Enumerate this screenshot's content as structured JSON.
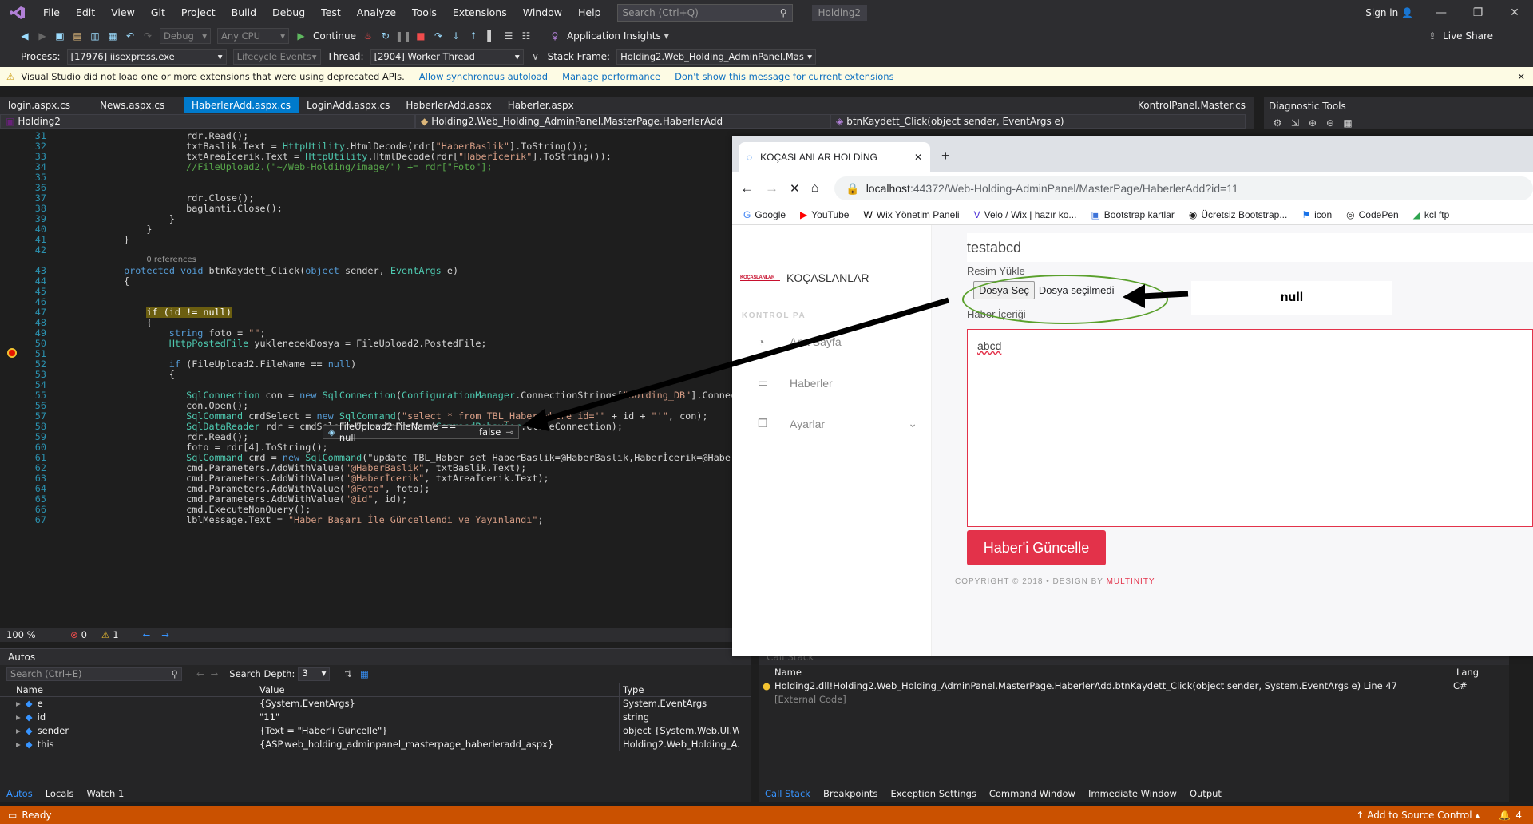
{
  "titlebar": {
    "menus": [
      "File",
      "Edit",
      "View",
      "Git",
      "Project",
      "Build",
      "Debug",
      "Test",
      "Analyze",
      "Tools",
      "Extensions",
      "Window",
      "Help"
    ],
    "search_placeholder": "Search (Ctrl+Q)",
    "solution": "Holding2",
    "signin": "Sign in"
  },
  "toolbar1": {
    "config": "Debug",
    "platform": "Any CPU",
    "continue": "Continue",
    "app_insights": "Application Insights",
    "live_share": "Live Share"
  },
  "toolbar2": {
    "process_label": "Process:",
    "process_value": "[17976] iisexpress.exe",
    "lifecycle": "Lifecycle Events",
    "thread_label": "Thread:",
    "thread_value": "[2904] Worker Thread",
    "stack_label": "Stack Frame:",
    "stack_value": "Holding2.Web_Holding_AdminPanel.Mas"
  },
  "infobar": {
    "message": "Visual Studio did not load one or more extensions that were using deprecated APIs.",
    "link1": "Allow synchronous autoload",
    "link2": "Manage performance",
    "link3": "Don't show this message for current extensions"
  },
  "tabs": [
    "login.aspx.cs",
    "News.aspx.cs",
    "HaberlerAdd.aspx.cs",
    "LoginAdd.aspx.cs",
    "HaberlerAdd.aspx",
    "Haberler.aspx",
    "KontrolPanel.Master.cs"
  ],
  "diagnostic_tools": "Diagnostic Tools",
  "navbar": {
    "project": "Holding2",
    "class": "Holding2.Web_Holding_AdminPanel.MasterPage.HaberlerAdd",
    "method": "btnKaydett_Click(object sender, EventArgs e)"
  },
  "code": [
    {
      "n": "31",
      "t": "rdr.Read();",
      "ind": 11
    },
    {
      "n": "32",
      "t": "txtBaslik.Text = HttpUtility.HtmlDecode(rdr[\"HaberBaslik\"].ToString());",
      "ind": 11
    },
    {
      "n": "33",
      "t": "txtAreaİcerik.Text = HttpUtility.HtmlDecode(rdr[\"Haberİcerik\"].ToString());",
      "ind": 11
    },
    {
      "n": "34",
      "t": "//FileUpload2.(\"~/Web-Holding/image/\") += rdr[\"Foto\"];",
      "ind": 11,
      "cm": true
    },
    {
      "n": "35",
      "t": "",
      "ind": 0
    },
    {
      "n": "36",
      "t": "",
      "ind": 0
    },
    {
      "n": "37",
      "t": "rdr.Close();",
      "ind": 11
    },
    {
      "n": "38",
      "t": "baglanti.Close();",
      "ind": 11
    },
    {
      "n": "39",
      "t": "}",
      "ind": 8
    },
    {
      "n": "40",
      "t": "}",
      "ind": 4
    },
    {
      "n": "41",
      "t": "}",
      "ind": 0
    },
    {
      "n": "42",
      "t": "",
      "ind": 0
    },
    {
      "n": "43",
      "t": "protected void btnKaydett_Click(object sender, EventArgs e)",
      "ind": 0
    },
    {
      "n": "44",
      "t": "{",
      "ind": 0
    },
    {
      "n": "45",
      "t": "",
      "ind": 0
    },
    {
      "n": "46",
      "t": "",
      "ind": 0
    },
    {
      "n": "47",
      "t": "if (id != null)",
      "ind": 4,
      "hl": true
    },
    {
      "n": "48",
      "t": "{",
      "ind": 4
    },
    {
      "n": "49",
      "t": "string foto = \"\";",
      "ind": 8
    },
    {
      "n": "50",
      "t": "HttpPostedFile yuklenecekDosya = FileUpload2.PostedFile;",
      "ind": 8
    },
    {
      "n": "51",
      "t": "",
      "ind": 0
    },
    {
      "n": "52",
      "t": "if (FileUpload2.FileName == null)",
      "ind": 8
    },
    {
      "n": "53",
      "t": "{",
      "ind": 8
    },
    {
      "n": "54",
      "t": "",
      "ind": 0
    },
    {
      "n": "55",
      "t": "SqlConnection con = new SqlConnection(ConfigurationManager.ConnectionStrings[\"Holding_DB\"].Connec",
      "ind": 11
    },
    {
      "n": "56",
      "t": "con.Open();",
      "ind": 11
    },
    {
      "n": "57",
      "t": "SqlCommand cmdSelect = new SqlCommand(\"select * from TBL_Haber where id='\" + id + \"'\", con);",
      "ind": 11
    },
    {
      "n": "58",
      "t": "SqlDataReader rdr = cmdSelect.ExecuteReader(CommandBehavior.CloseConnection);",
      "ind": 11
    },
    {
      "n": "59",
      "t": "rdr.Read();",
      "ind": 11
    },
    {
      "n": "60",
      "t": "foto = rdr[4].ToString();",
      "ind": 11
    },
    {
      "n": "61",
      "t": "SqlCommand cmd = new SqlCommand(\"update TBL_Haber set HaberBaslik=@HaberBaslik,Haberİcerik=@Haber",
      "ind": 11
    },
    {
      "n": "62",
      "t": "cmd.Parameters.AddWithValue(\"@HaberBaslik\", txtBaslik.Text);",
      "ind": 11
    },
    {
      "n": "63",
      "t": "cmd.Parameters.AddWithValue(\"@Haberİcerik\", txtAreaİcerik.Text);",
      "ind": 11
    },
    {
      "n": "64",
      "t": "cmd.Parameters.AddWithValue(\"@Foto\", foto);",
      "ind": 11
    },
    {
      "n": "65",
      "t": "cmd.Parameters.AddWithValue(\"@id\", id);",
      "ind": 11
    },
    {
      "n": "66",
      "t": "cmd.ExecuteNonQuery();",
      "ind": 11
    },
    {
      "n": "67",
      "t": "lblMessage.Text = \"Haber Başarı İle Güncellendi ve Yayınlandı\";",
      "ind": 11
    }
  ],
  "refs": "0 references",
  "datatip": {
    "expr": "FileUpload2.FileName == null",
    "value": "false"
  },
  "editor_status": {
    "zoom": "100 %",
    "errors": "0",
    "warnings": "1"
  },
  "autos": {
    "title": "Autos",
    "search": "Search (Ctrl+E)",
    "depth_label": "Search Depth:",
    "depth": "3",
    "headers": [
      "Name",
      "Value",
      "Type"
    ],
    "rows": [
      {
        "name": "e",
        "value": "{System.EventArgs}",
        "type": "System.EventArgs"
      },
      {
        "name": "id",
        "value": "\"11\"",
        "type": "string"
      },
      {
        "name": "sender",
        "value": "{Text = \"Haber'i Güncelle\"}",
        "type": "object {System.Web.UI.W..."
      },
      {
        "name": "this",
        "value": "{ASP.web_holding_adminpanel_masterpage_haberleradd_aspx}",
        "type": "Holding2.Web_Holding_A..."
      }
    ],
    "tabs": [
      "Autos",
      "Locals",
      "Watch 1"
    ]
  },
  "callstack": {
    "title": "Call Stack",
    "headers": [
      "Name",
      "Lang"
    ],
    "rows": [
      {
        "name": "Holding2.dll!Holding2.Web_Holding_AdminPanel.MasterPage.HaberlerAdd.btnKaydett_Click(object sender, System.EventArgs e) Line 47",
        "lang": "C#"
      },
      {
        "name": "[External Code]",
        "lang": ""
      }
    ],
    "tabs": [
      "Call Stack",
      "Breakpoints",
      "Exception Settings",
      "Command Window",
      "Immediate Window",
      "Output"
    ]
  },
  "statusbar": {
    "ready": "Ready",
    "source_control": "Add to Source Control",
    "notifications": "4"
  },
  "browser": {
    "tab_title": "KOÇASLANLAR HOLDİNG",
    "url_host": "localhost",
    "url_rest": ":44372/Web-Holding-AdminPanel/MasterPage/HaberlerAdd?id=11",
    "bookmarks": [
      "Google",
      "YouTube",
      "Wix Yönetim Paneli",
      "Velo / Wix | hazır ko...",
      "Bootstrap kartlar",
      "Ücretsiz Bootstrap...",
      "icon",
      "CodePen",
      "kcl ftp"
    ],
    "brand": "KOÇASLANLAR",
    "logo_text": "KOÇASLANLAR",
    "section": "KONTROL PA",
    "nav": [
      "Ana Sayfa",
      "Haberler",
      "Ayarlar"
    ],
    "title_value": "testabcd",
    "upload_label": "Resim Yükle",
    "choose_btn": "Dosya Seç",
    "no_file": "Dosya seçilmedi",
    "content_label": "Haber İçeriği",
    "content_value": "abcd",
    "update_btn": "Haber'i Güncelle",
    "footer_copy": "COPYRIGHT © 2018 •  DESIGN BY",
    "footer_brand": "MULTINITY"
  },
  "annotation": {
    "null_text": "null"
  }
}
